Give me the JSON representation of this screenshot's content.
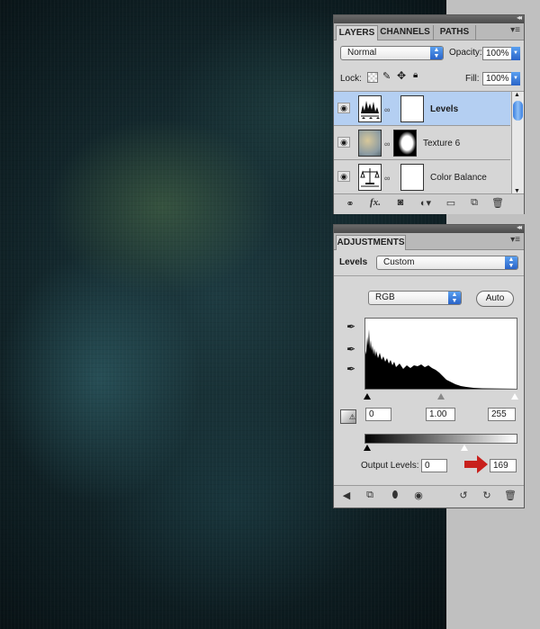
{
  "layers_panel": {
    "tabs": [
      "LAYERS",
      "CHANNELS",
      "PATHS"
    ],
    "blend_mode": "Normal",
    "opacity_label": "Opacity:",
    "opacity_value": "100%",
    "lock_label": "Lock:",
    "fill_label": "Fill:",
    "fill_value": "100%",
    "layers": [
      {
        "name": "Levels",
        "selected": true
      },
      {
        "name": "Texture 6",
        "selected": false
      },
      {
        "name": "Color Balance",
        "selected": false
      }
    ],
    "footer_icons": [
      "link-icon",
      "fx-icon",
      "mask-icon",
      "adjustment-icon",
      "folder-icon",
      "new-layer-icon",
      "trash-icon"
    ]
  },
  "adjustments_panel": {
    "tab": "ADJUSTMENTS",
    "levels_label": "Levels",
    "preset": "Custom",
    "channel": "RGB",
    "auto_label": "Auto",
    "input_black": "0",
    "input_gamma": "1.00",
    "input_white": "255",
    "output_label": "Output Levels:",
    "output_black": "0",
    "output_white": "169",
    "accent_color": "#c8201c",
    "selection_color": "#b4cff2",
    "footer_icons": [
      "back-icon",
      "expand-icon",
      "clip-icon",
      "visibility-icon",
      "previous-state-icon",
      "reset-icon",
      "trash-icon"
    ]
  }
}
